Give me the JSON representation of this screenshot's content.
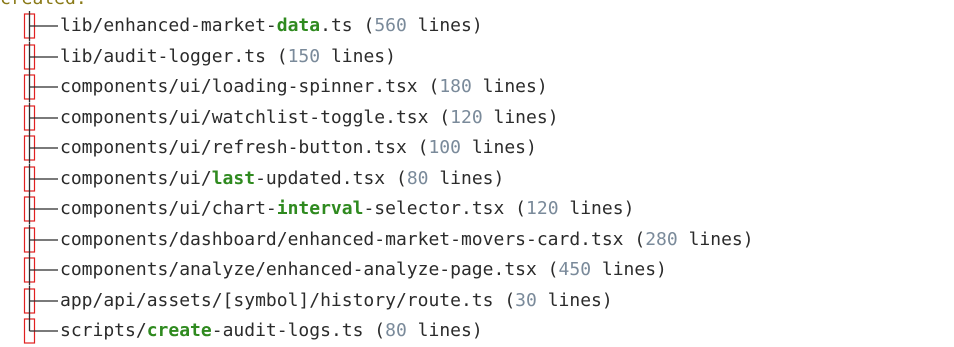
{
  "heading": "created:",
  "files": [
    {
      "pre": "lib/enhanced-market-",
      "hl": "data",
      "post": ".ts",
      "open": " (",
      "num": "560",
      "close": " lines)",
      "connector": "branch"
    },
    {
      "pre": "lib/audit-logger.ts",
      "hl": "",
      "post": "",
      "open": " (",
      "num": "150",
      "close": " lines)",
      "connector": "branch"
    },
    {
      "pre": "components/ui/loading-spinner.tsx",
      "hl": "",
      "post": "",
      "open": " (",
      "num": "180",
      "close": " lines)",
      "connector": "branch"
    },
    {
      "pre": "components/ui/watchlist-toggle.tsx",
      "hl": "",
      "post": "",
      "open": " (",
      "num": "120",
      "close": " lines)",
      "connector": "branch"
    },
    {
      "pre": "components/ui/refresh-button.tsx",
      "hl": "",
      "post": "",
      "open": " (",
      "num": "100",
      "close": " lines)",
      "connector": "branch"
    },
    {
      "pre": "components/ui/",
      "hl": "last",
      "post": "-updated.tsx",
      "open": " (",
      "num": "80",
      "close": " lines)",
      "connector": "branch"
    },
    {
      "pre": "components/ui/chart-",
      "hl": "interval",
      "post": "-selector.tsx",
      "open": " (",
      "num": "120",
      "close": " lines)",
      "connector": "branch"
    },
    {
      "pre": "components/dashboard/enhanced-market-movers-card.tsx",
      "hl": "",
      "post": "",
      "open": " (",
      "num": "280",
      "close": " lines)",
      "connector": "branch"
    },
    {
      "pre": "components/analyze/enhanced-analyze-page.tsx",
      "hl": "",
      "post": "",
      "open": " (",
      "num": "450",
      "close": " lines)",
      "connector": "branch"
    },
    {
      "pre": "app/api/assets/[symbol]/history/route.ts",
      "hl": "",
      "post": "",
      "open": " (",
      "num": "30",
      "close": " lines)",
      "connector": "branch"
    },
    {
      "pre": "scripts/",
      "hl": "create",
      "post": "-audit-logs.ts",
      "open": " (",
      "num": "80",
      "close": " lines)",
      "connector": "last"
    }
  ],
  "colors": {
    "heading": "#8a7a18",
    "highlight": "#2f8a1f",
    "number": "#7a8a9a",
    "connector_box": "#e02020",
    "connector_line": "#2b2b2b"
  }
}
